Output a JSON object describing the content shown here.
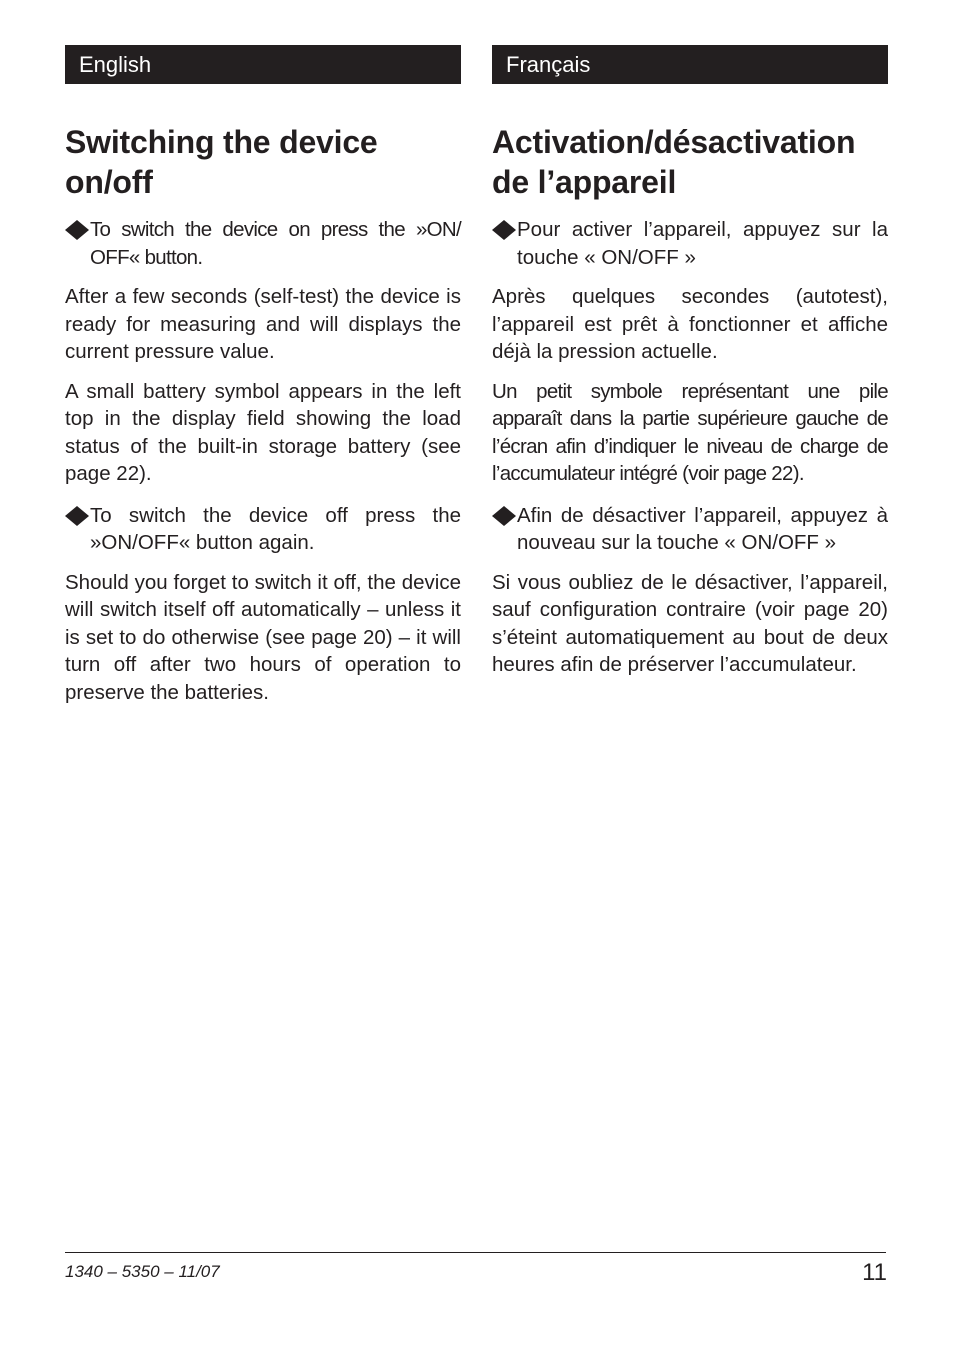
{
  "english": {
    "language_label": "English",
    "title": "Switching the device on/off",
    "bullet_1": "To switch the device on press the »ON/ OFF« button.",
    "para_1": "After a few seconds (self-test) the de­vice is ready for measuring and will dis­plays the current pressure value.",
    "para_2": "A small battery symbol appears in the left top in the display field showing the load status of the built-in storage batte­ry (see page 22).",
    "bullet_2": "To switch the device off press the »ON/OFF« button again.",
    "para_3": "Should you forget to switch it off, the device will switch itself off automatical­ly – unless it is  set to do otherwise (see page 20) – it will turn off after two hours of operation to preserve the batteries."
  },
  "french": {
    "language_label": "Français",
    "title": "Activation/désactivation de l’appareil",
    "bullet_1": "Pour activer l’appareil, appuyez sur la touche « ON/OFF »",
    "para_1": "Après quelques secondes (autotest), l’appareil est prêt à fonctionner et affiche déjà la pression actuelle.",
    "para_2": "Un petit symbole représentant une pile apparaît dans la partie supérieure gauche de l’écran afin d’indiquer le niveau de char­ge de l’accumulateur intégré (voir page 22).",
    "bullet_2": "Afin de désactiver l’appareil, appuyez à nouveau sur la touche « ON/OFF »",
    "para_3": "Si vous oubliez de le désactiver, l’appareil, sauf configuration contraire (voir page 20) s’éteint automatiquement au bout de deux heures afin de préser­ver l’accumulateur."
  },
  "footer": {
    "document_code": "1340 – 5350 – 11/07",
    "page_number": "11"
  },
  "icons": {
    "bullet": "diamond-bullet-icon"
  },
  "colors": {
    "text": "#231f20",
    "header_bar": "#231f20",
    "header_text": "#ffffff"
  }
}
